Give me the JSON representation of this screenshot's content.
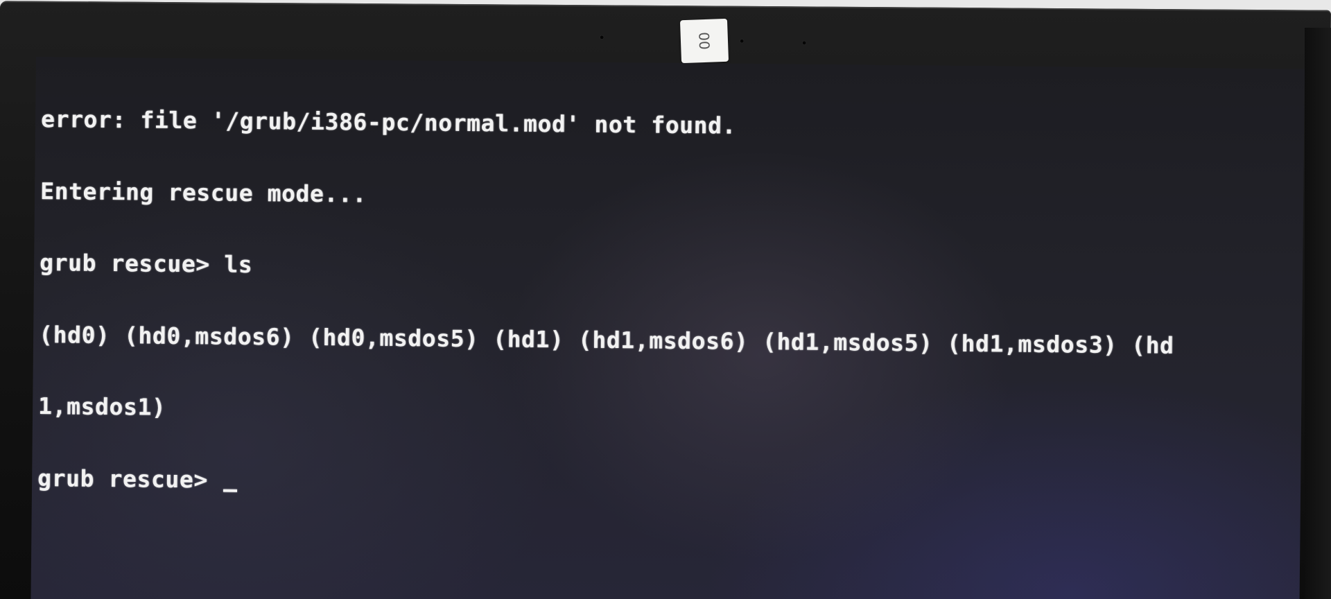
{
  "sticker": {
    "text": "00"
  },
  "terminal": {
    "lines": [
      "error: file '/grub/i386-pc/normal.mod' not found.",
      "Entering rescue mode...",
      "grub rescue> ls",
      "(hd0) (hd0,msdos6) (hd0,msdos5) (hd1) (hd1,msdos6) (hd1,msdos5) (hd1,msdos3) (hd",
      "1,msdos1)"
    ],
    "prompt": "grub rescue> ",
    "cursor_char": "_"
  }
}
